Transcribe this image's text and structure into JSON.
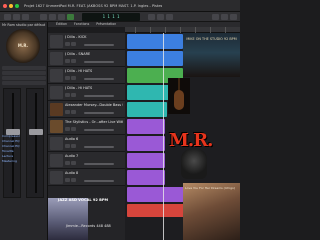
{
  "window": {
    "title": "Projet 1627 UnmeetPod M.R. FEAT. JAKBOSS 92 BPM MAST. 1.P. Ingles - Pistes"
  },
  "menu": {
    "items": [
      "Édition",
      "Fonctions",
      "Présentation"
    ]
  },
  "transport": {
    "lcd": "1  1  1  1"
  },
  "inspector": {
    "header": "Mr Rom studio par défaut",
    "logo_text": "M.R.",
    "list": [
      "Compressor",
      "Channel EQ",
      "Channel EQ",
      "Tonalité",
      "Lecture",
      "Mastering"
    ]
  },
  "tracks": [
    {
      "name": "J Dilla - KICK",
      "thumb_color": "#3b3b3f"
    },
    {
      "name": "J Dilla - SNARE",
      "thumb_color": "#3b3b3f"
    },
    {
      "name": "J Dilla - HI HATS",
      "thumb_color": "#3b3b3f"
    },
    {
      "name": "J Dilla - Hi HATS",
      "thumb_color": "#3b3b3f"
    },
    {
      "name": "Alexander Mursey...Double Bass Solo",
      "thumb_color": "#5a3a22"
    },
    {
      "name": "The Stylistics - Or...after Live With Me",
      "thumb_color": "#6a4b2c"
    },
    {
      "name": "Audio 6",
      "thumb_color": "#3b3b3f"
    },
    {
      "name": "Audio 7",
      "thumb_color": "#3b3b3f"
    },
    {
      "name": "Audio 8",
      "thumb_color": "#3b3b3f"
    },
    {
      "name": "JAZZ ASD VOCAL 92 BPM",
      "thumb_color": "#3b3b3f"
    },
    {
      "name": "Jimmie...Records 448 488",
      "thumb_color": "#3b3b3f"
    }
  ],
  "artwork": {
    "album1": "MIKE ON THE STUDIO 92 BPM",
    "mr_logo": "M.R.",
    "album2": "Love You For Her Dreams (Ichigo)",
    "jazz_header": "JAZZ ASD VOCAL 92 BPM",
    "jazz_label": "Jimmie...Records 448 488"
  },
  "colors": {
    "region_blue": "#3c7fe0",
    "region_purple": "#9a59d6",
    "region_green": "#4caf50",
    "region_teal": "#2fb7b0",
    "region_red": "#d6453c"
  }
}
